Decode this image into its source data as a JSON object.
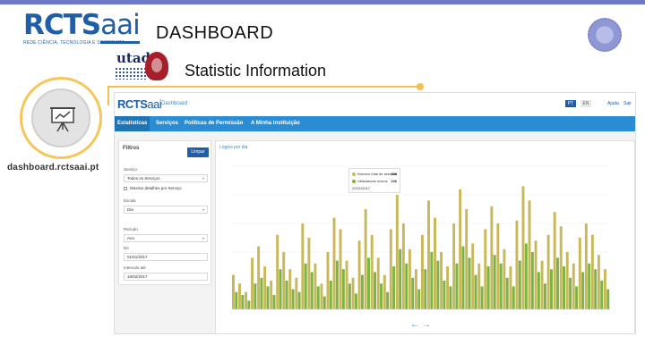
{
  "header": {
    "logo": "RCTS",
    "logo_suffix": "aai",
    "logo_tagline": "REDE CIÊNCIA, TECNOLOGIA E SOCIEDADE",
    "title": "DASHBOARD",
    "partner_logo": "utad",
    "subtitle": "Statistic Information",
    "site_url": "dashboard.rctsaai.pt"
  },
  "colors": {
    "accent_yellow": "#f2c04f",
    "brand_blue": "#1f5ea8",
    "nav_blue": "#2a8dd4",
    "series_olive": "#c8b85a",
    "series_green": "#7cb342"
  },
  "dashboard": {
    "brand": "RCTS",
    "brand_suffix": "aai",
    "brand_label": "Dashboard",
    "languages": [
      "PT",
      "EN"
    ],
    "top_links": [
      "Ajuda",
      "Sair"
    ],
    "nav_tabs": [
      "Estatísticas",
      "Serviços",
      "Políticas de Permissão",
      "A Minha Instituição"
    ],
    "filters": {
      "title": "Filtros",
      "button": "Limpar",
      "service_label": "Serviço",
      "service_value": "Todos os Serviços",
      "checkbox_label": "Mostrar detalhes por Serviço",
      "period_unit_label": "Escala",
      "period_unit_value": "Dia",
      "period_label": "Período",
      "period_value": "Ano",
      "from_label": "De",
      "from_value": "01/01/2017",
      "to_label": "Intervalo até",
      "to_value": "18/02/2017"
    },
    "chart": {
      "title": "Logins por dia",
      "legend": [
        {
          "name": "Número total de acessos",
          "value": "398"
        },
        {
          "name": "Utilizadores únicos",
          "value": "196"
        }
      ],
      "legend_date": "22/01/2017"
    }
  },
  "chart_data": {
    "type": "bar",
    "title": "Logins por dia",
    "series": [
      {
        "name": "Número total de acessos",
        "color": "#c8b85a",
        "values": [
          120,
          90,
          60,
          180,
          220,
          150,
          100,
          260,
          200,
          140,
          110,
          300,
          250,
          160,
          90,
          200,
          320,
          280,
          170,
          110,
          240,
          350,
          260,
          180,
          120,
          280,
          400,
          300,
          210,
          140,
          260,
          380,
          320,
          200,
          150,
          300,
          420,
          350,
          230,
          160,
          280,
          360,
          300,
          210,
          150,
          310,
          430,
          380,
          240,
          170,
          260,
          340,
          290,
          200,
          160,
          250,
          300,
          260,
          190,
          140
        ]
      },
      {
        "name": "Utilizadores únicos",
        "color": "#7cb342",
        "values": [
          60,
          50,
          30,
          90,
          110,
          80,
          50,
          140,
          100,
          70,
          60,
          160,
          130,
          80,
          45,
          100,
          170,
          140,
          90,
          55,
          120,
          180,
          130,
          90,
          60,
          150,
          210,
          160,
          110,
          70,
          140,
          200,
          170,
          100,
          80,
          160,
          220,
          180,
          120,
          80,
          150,
          190,
          160,
          110,
          80,
          170,
          230,
          200,
          130,
          90,
          140,
          180,
          150,
          110,
          80,
          130,
          160,
          140,
          100,
          70
        ]
      }
    ],
    "ylim": [
      0,
      500
    ],
    "grid": true
  }
}
